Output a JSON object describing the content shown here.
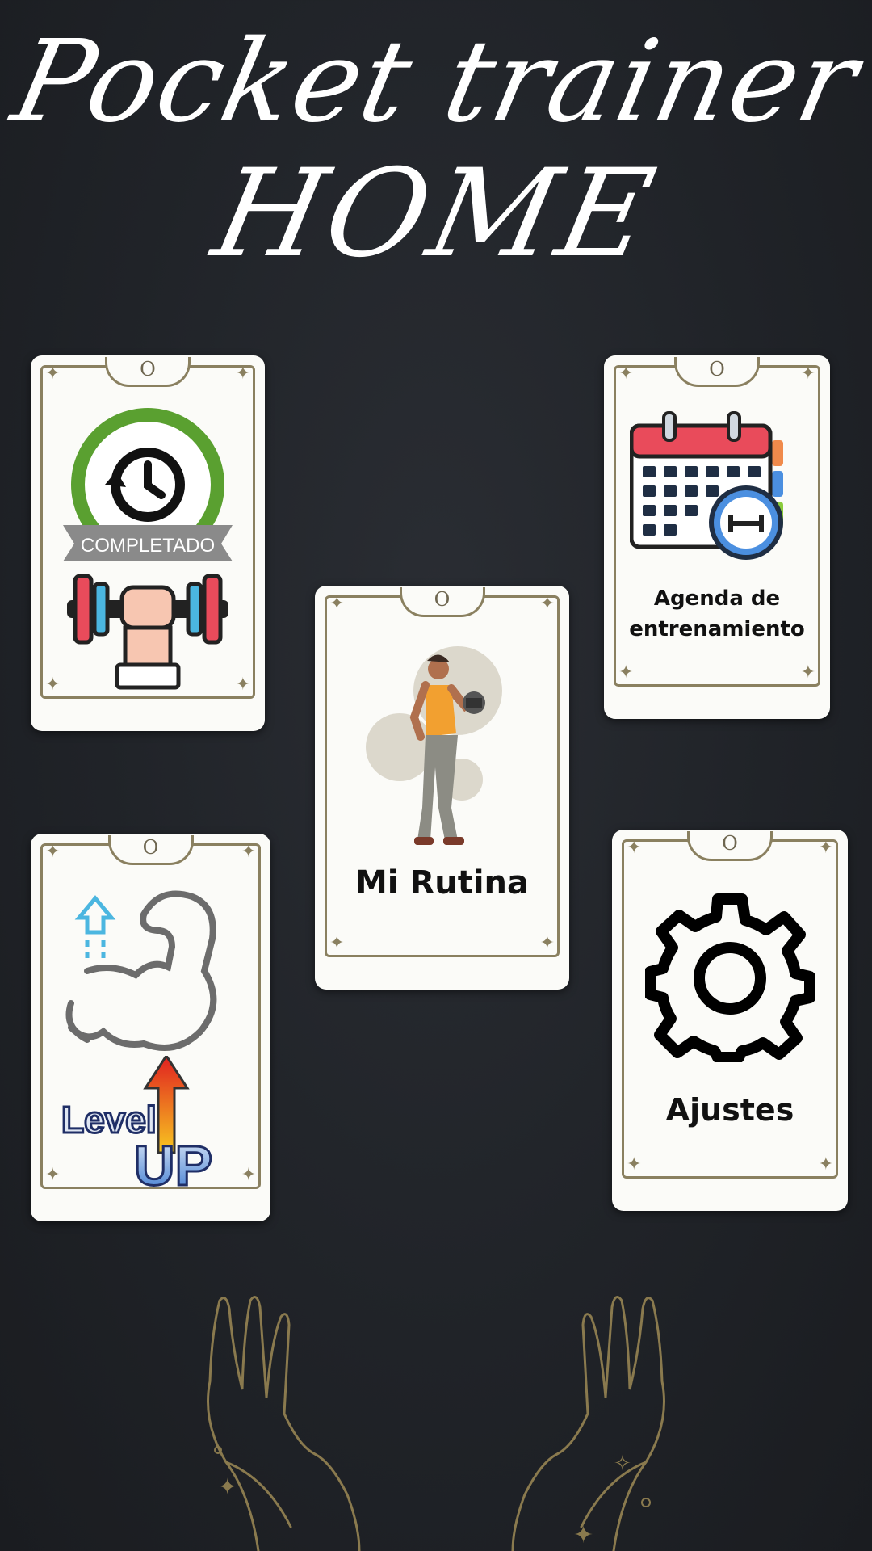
{
  "header": {
    "line1": "Pocket trainer",
    "line2": "HOME"
  },
  "cards": {
    "completed": {
      "badge": "COMPLETADO"
    },
    "schedule": {
      "label": "Agenda de entrenamiento"
    },
    "routine": {
      "label": "Mi Rutina"
    },
    "progress": {
      "level": "Level",
      "up": "UP"
    },
    "settings": {
      "label": "Ajustes"
    }
  },
  "colors": {
    "background": "#202328",
    "card": "#fbfbf8",
    "frame": "#8a8060"
  }
}
